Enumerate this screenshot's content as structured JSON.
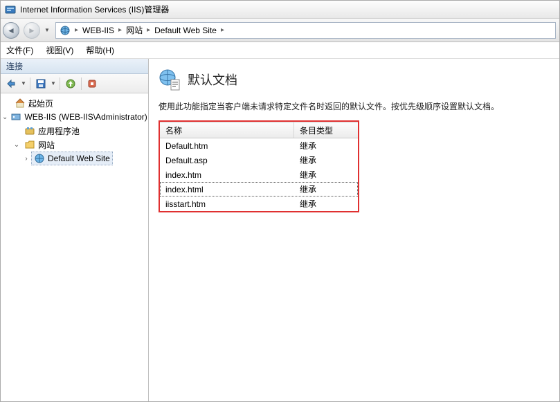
{
  "title": "Internet Information Services (IIS)管理器",
  "breadcrumb": {
    "seg1": "WEB-IIS",
    "seg2": "网站",
    "seg3": "Default Web Site"
  },
  "menu": {
    "file": "文件(F)",
    "view": "视图(V)",
    "help": "帮助(H)"
  },
  "sidebar": {
    "header": "连接",
    "nodes": {
      "start": "起始页",
      "server": "WEB-IIS (WEB-IIS\\Administrator)",
      "apppools": "应用程序池",
      "sites": "网站",
      "site0": "Default Web Site"
    }
  },
  "main": {
    "title": "默认文档",
    "subtitle": "使用此功能指定当客户端未请求特定文件名时返回的默认文件。按优先级顺序设置默认文档。",
    "col_name": "名称",
    "col_type": "条目类型",
    "rows": [
      {
        "name": "Default.htm",
        "type": "继承"
      },
      {
        "name": "Default.asp",
        "type": "继承"
      },
      {
        "name": "index.htm",
        "type": "继承"
      },
      {
        "name": "index.html",
        "type": "继承",
        "selected": true
      },
      {
        "name": "iisstart.htm",
        "type": "继承"
      }
    ]
  }
}
